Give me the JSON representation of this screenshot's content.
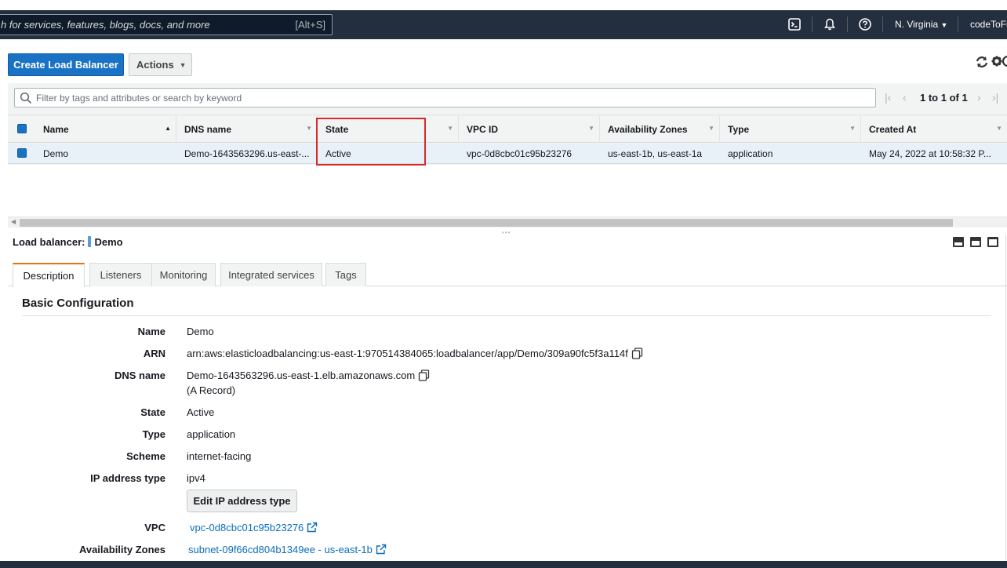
{
  "header": {
    "search_placeholder": "h for services, features, blogs, docs, and more",
    "search_shortcut": "[Alt+S]",
    "region": "N. Virginia",
    "account": "codeToFu"
  },
  "toolbar": {
    "create_label": "Create Load Balancer",
    "actions_label": "Actions"
  },
  "filter": {
    "placeholder": "Filter by tags and attributes or search by keyword"
  },
  "pagination": {
    "text": "1 to 1 of 1"
  },
  "table": {
    "columns": [
      "Name",
      "DNS name",
      "State",
      "VPC ID",
      "Availability Zones",
      "Type",
      "Created At"
    ],
    "rows": [
      {
        "name": "Demo",
        "dns": "Demo-1643563296.us-east-...",
        "state": "Active",
        "vpc": "vpc-0d8cbc01c95b23276",
        "zones": "us-east-1b, us-east-1a",
        "type": "application",
        "created": "May 24, 2022 at 10:58:32 P..."
      }
    ]
  },
  "detail": {
    "title_prefix": "Load balancer:",
    "title_name": "Demo",
    "tabs": [
      "Description",
      "Listeners",
      "Monitoring",
      "Integrated services",
      "Tags"
    ],
    "section_title": "Basic Configuration",
    "fields": {
      "name_label": "Name",
      "name_value": "Demo",
      "arn_label": "ARN",
      "arn_value": "arn:aws:elasticloadbalancing:us-east-1:970514384065:loadbalancer/app/Demo/309a90fc5f3a114f",
      "dns_label": "DNS name",
      "dns_value": "Demo-1643563296.us-east-1.elb.amazonaws.com",
      "dns_note": "(A Record)",
      "state_label": "State",
      "state_value": "Active",
      "type_label": "Type",
      "type_value": "application",
      "scheme_label": "Scheme",
      "scheme_value": "internet-facing",
      "ip_label": "IP address type",
      "ip_value": "ipv4",
      "edit_ip_button": "Edit IP address type",
      "vpc_label": "VPC",
      "vpc_value": "vpc-0d8cbc01c95b23276",
      "az_label": "Availability Zones",
      "az_value": "subnet-09f66cd804b1349ee - us-east-1b"
    }
  },
  "colors": {
    "primary": "#1a72c5",
    "highlight": "#d52b2b",
    "link": "#0a6ebd",
    "tab_accent": "#ec7211",
    "nav_bg": "#232f3e"
  }
}
